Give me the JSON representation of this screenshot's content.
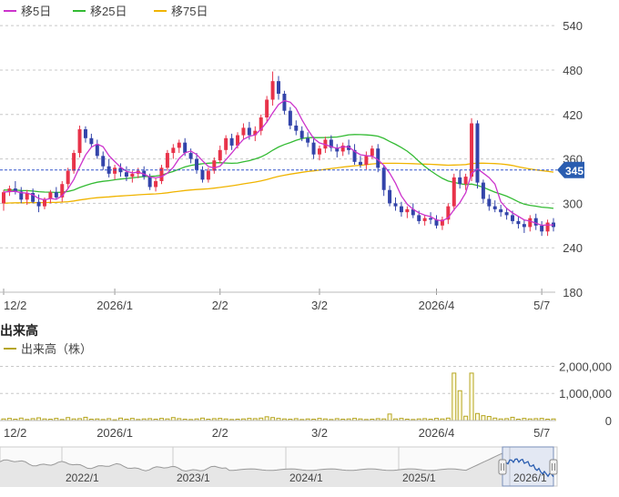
{
  "chart_data": [
    {
      "type": "candlestick",
      "legend": [
        {
          "name": "移5日",
          "color": "#cc33cc"
        },
        {
          "name": "移25日",
          "color": "#33bb33"
        },
        {
          "name": "移75日",
          "color": "#f0b400"
        }
      ],
      "y_ticks": [
        180,
        240,
        300,
        360,
        420,
        480,
        540
      ],
      "ylim": [
        180,
        550
      ],
      "current_price": 345,
      "x_tick_labels": [
        {
          "label": "12/2",
          "index": 0
        },
        {
          "label": "2026/1",
          "index": 19
        },
        {
          "label": "2/2",
          "index": 37
        },
        {
          "label": "3/2",
          "index": 54
        },
        {
          "label": "2026/4",
          "index": 74
        },
        {
          "label": "5/7",
          "index": 92
        }
      ],
      "up_color": "#e8334a",
      "down_color": "#3344aa",
      "candles": [
        [
          300,
          318,
          290,
          315
        ],
        [
          315,
          324,
          310,
          320
        ],
        [
          320,
          330,
          312,
          316
        ],
        [
          316,
          322,
          300,
          305
        ],
        [
          305,
          318,
          298,
          314
        ],
        [
          314,
          320,
          300,
          302
        ],
        [
          302,
          312,
          288,
          296
        ],
        [
          296,
          308,
          292,
          306
        ],
        [
          306,
          318,
          300,
          315
        ],
        [
          315,
          322,
          305,
          308
        ],
        [
          308,
          330,
          302,
          326
        ],
        [
          326,
          348,
          320,
          344
        ],
        [
          344,
          372,
          340,
          368
        ],
        [
          368,
          405,
          362,
          400
        ],
        [
          400,
          404,
          382,
          388
        ],
        [
          388,
          394,
          376,
          380
        ],
        [
          380,
          386,
          360,
          364
        ],
        [
          364,
          370,
          345,
          350
        ],
        [
          350,
          360,
          335,
          340
        ],
        [
          340,
          352,
          332,
          348
        ],
        [
          348,
          354,
          336,
          342
        ],
        [
          342,
          350,
          330,
          336
        ],
        [
          336,
          344,
          328,
          340
        ],
        [
          340,
          348,
          334,
          344
        ],
        [
          344,
          350,
          332,
          336
        ],
        [
          336,
          340,
          318,
          322
        ],
        [
          322,
          334,
          316,
          330
        ],
        [
          330,
          352,
          326,
          348
        ],
        [
          348,
          372,
          344,
          368
        ],
        [
          368,
          380,
          360,
          375
        ],
        [
          375,
          386,
          368,
          382
        ],
        [
          382,
          388,
          364,
          368
        ],
        [
          368,
          374,
          354,
          360
        ],
        [
          360,
          368,
          340,
          345
        ],
        [
          345,
          350,
          328,
          332
        ],
        [
          332,
          348,
          328,
          344
        ],
        [
          344,
          362,
          340,
          358
        ],
        [
          358,
          378,
          354,
          372
        ],
        [
          372,
          392,
          366,
          388
        ],
        [
          388,
          394,
          372,
          378
        ],
        [
          378,
          396,
          374,
          392
        ],
        [
          392,
          408,
          386,
          402
        ],
        [
          402,
          410,
          386,
          392
        ],
        [
          392,
          404,
          384,
          398
        ],
        [
          398,
          420,
          392,
          416
        ],
        [
          416,
          445,
          410,
          440
        ],
        [
          440,
          478,
          432,
          465
        ],
        [
          465,
          472,
          440,
          448
        ],
        [
          448,
          452,
          420,
          425
        ],
        [
          425,
          430,
          400,
          405
        ],
        [
          405,
          412,
          392,
          398
        ],
        [
          398,
          404,
          384,
          388
        ],
        [
          388,
          396,
          376,
          382
        ],
        [
          382,
          390,
          360,
          366
        ],
        [
          366,
          378,
          358,
          374
        ],
        [
          374,
          390,
          368,
          386
        ],
        [
          386,
          392,
          370,
          375
        ],
        [
          375,
          380,
          362,
          370
        ],
        [
          370,
          382,
          364,
          378
        ],
        [
          378,
          386,
          366,
          372
        ],
        [
          372,
          380,
          352,
          356
        ],
        [
          356,
          364,
          348,
          352
        ],
        [
          352,
          370,
          346,
          364
        ],
        [
          364,
          378,
          360,
          374
        ],
        [
          374,
          380,
          342,
          348
        ],
        [
          348,
          352,
          310,
          318
        ],
        [
          318,
          324,
          296,
          300
        ],
        [
          300,
          308,
          290,
          296
        ],
        [
          296,
          302,
          282,
          288
        ],
        [
          288,
          296,
          280,
          292
        ],
        [
          292,
          300,
          280,
          284
        ],
        [
          284,
          290,
          272,
          276
        ],
        [
          276,
          284,
          270,
          280
        ],
        [
          280,
          288,
          272,
          278
        ],
        [
          278,
          284,
          266,
          270
        ],
        [
          270,
          282,
          264,
          278
        ],
        [
          278,
          300,
          272,
          296
        ],
        [
          296,
          340,
          290,
          335
        ],
        [
          335,
          345,
          320,
          326
        ],
        [
          326,
          340,
          318,
          336
        ],
        [
          336,
          415,
          330,
          408
        ],
        [
          408,
          412,
          320,
          328
        ],
        [
          328,
          332,
          300,
          306
        ],
        [
          306,
          312,
          290,
          296
        ],
        [
          296,
          304,
          288,
          292
        ],
        [
          292,
          298,
          282,
          288
        ],
        [
          288,
          294,
          278,
          284
        ],
        [
          284,
          290,
          272,
          276
        ],
        [
          276,
          282,
          266,
          272
        ],
        [
          272,
          278,
          260,
          268
        ],
        [
          268,
          284,
          262,
          280
        ],
        [
          280,
          286,
          264,
          270
        ],
        [
          270,
          276,
          256,
          262
        ],
        [
          262,
          278,
          256,
          274
        ],
        [
          274,
          280,
          262,
          268
        ]
      ],
      "volume": {
        "label": "出来高",
        "series_name": "出来高（株）",
        "color": "#b5a520",
        "y_ticks": [
          {
            "value": 0,
            "label": "0"
          },
          {
            "value": 1000000,
            "label": "1,000,000"
          },
          {
            "value": 2000000,
            "label": "2,000,000"
          }
        ],
        "values": [
          60000,
          80000,
          50000,
          90000,
          40000,
          70000,
          100000,
          60000,
          50000,
          80000,
          40000,
          110000,
          60000,
          70000,
          120000,
          50000,
          60000,
          40000,
          70000,
          30000,
          90000,
          50000,
          80000,
          40000,
          60000,
          70000,
          50000,
          80000,
          60000,
          110000,
          70000,
          50000,
          40000,
          60000,
          90000,
          50000,
          70000,
          80000,
          60000,
          40000,
          50000,
          60000,
          80000,
          70000,
          90000,
          140000,
          110000,
          80000,
          60000,
          50000,
          70000,
          40000,
          60000,
          50000,
          80000,
          60000,
          40000,
          70000,
          50000,
          60000,
          80000,
          60000,
          40000,
          50000,
          70000,
          60000,
          240000,
          60000,
          80000,
          50000,
          40000,
          60000,
          70000,
          50000,
          80000,
          60000,
          90000,
          1750000,
          1100000,
          160000,
          1750000,
          260000,
          180000,
          150000,
          90000,
          60000,
          70000,
          120000,
          50000,
          80000,
          60000,
          70000,
          80000,
          50000,
          60000
        ]
      }
    },
    {
      "type": "area",
      "role": "navigator",
      "x_labels": [
        "2022/1",
        "2023/1",
        "2024/1",
        "2025/1",
        "2026/1"
      ]
    }
  ]
}
